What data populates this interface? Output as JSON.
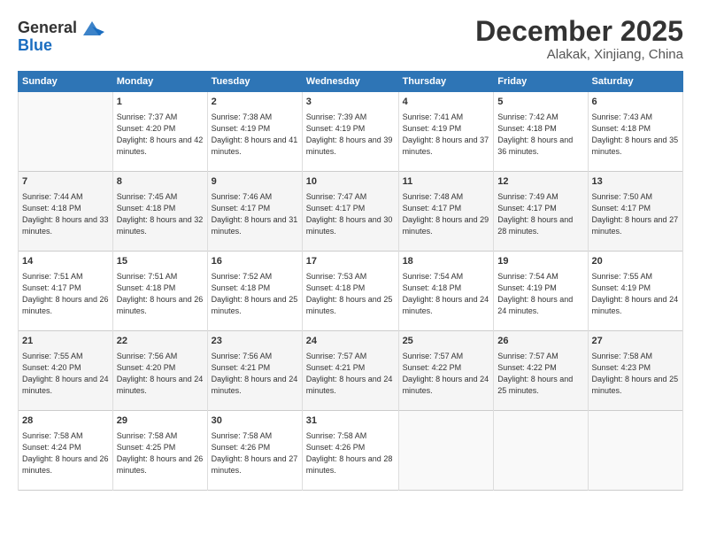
{
  "header": {
    "logo_line1": "General",
    "logo_line2": "Blue",
    "month_year": "December 2025",
    "location": "Alakak, Xinjiang, China"
  },
  "weekdays": [
    "Sunday",
    "Monday",
    "Tuesday",
    "Wednesday",
    "Thursday",
    "Friday",
    "Saturday"
  ],
  "weeks": [
    [
      {
        "day": "",
        "sunrise": "",
        "sunset": "",
        "daylight": ""
      },
      {
        "day": "1",
        "sunrise": "Sunrise: 7:37 AM",
        "sunset": "Sunset: 4:20 PM",
        "daylight": "Daylight: 8 hours and 42 minutes."
      },
      {
        "day": "2",
        "sunrise": "Sunrise: 7:38 AM",
        "sunset": "Sunset: 4:19 PM",
        "daylight": "Daylight: 8 hours and 41 minutes."
      },
      {
        "day": "3",
        "sunrise": "Sunrise: 7:39 AM",
        "sunset": "Sunset: 4:19 PM",
        "daylight": "Daylight: 8 hours and 39 minutes."
      },
      {
        "day": "4",
        "sunrise": "Sunrise: 7:41 AM",
        "sunset": "Sunset: 4:19 PM",
        "daylight": "Daylight: 8 hours and 37 minutes."
      },
      {
        "day": "5",
        "sunrise": "Sunrise: 7:42 AM",
        "sunset": "Sunset: 4:18 PM",
        "daylight": "Daylight: 8 hours and 36 minutes."
      },
      {
        "day": "6",
        "sunrise": "Sunrise: 7:43 AM",
        "sunset": "Sunset: 4:18 PM",
        "daylight": "Daylight: 8 hours and 35 minutes."
      }
    ],
    [
      {
        "day": "7",
        "sunrise": "Sunrise: 7:44 AM",
        "sunset": "Sunset: 4:18 PM",
        "daylight": "Daylight: 8 hours and 33 minutes."
      },
      {
        "day": "8",
        "sunrise": "Sunrise: 7:45 AM",
        "sunset": "Sunset: 4:18 PM",
        "daylight": "Daylight: 8 hours and 32 minutes."
      },
      {
        "day": "9",
        "sunrise": "Sunrise: 7:46 AM",
        "sunset": "Sunset: 4:17 PM",
        "daylight": "Daylight: 8 hours and 31 minutes."
      },
      {
        "day": "10",
        "sunrise": "Sunrise: 7:47 AM",
        "sunset": "Sunset: 4:17 PM",
        "daylight": "Daylight: 8 hours and 30 minutes."
      },
      {
        "day": "11",
        "sunrise": "Sunrise: 7:48 AM",
        "sunset": "Sunset: 4:17 PM",
        "daylight": "Daylight: 8 hours and 29 minutes."
      },
      {
        "day": "12",
        "sunrise": "Sunrise: 7:49 AM",
        "sunset": "Sunset: 4:17 PM",
        "daylight": "Daylight: 8 hours and 28 minutes."
      },
      {
        "day": "13",
        "sunrise": "Sunrise: 7:50 AM",
        "sunset": "Sunset: 4:17 PM",
        "daylight": "Daylight: 8 hours and 27 minutes."
      }
    ],
    [
      {
        "day": "14",
        "sunrise": "Sunrise: 7:51 AM",
        "sunset": "Sunset: 4:17 PM",
        "daylight": "Daylight: 8 hours and 26 minutes."
      },
      {
        "day": "15",
        "sunrise": "Sunrise: 7:51 AM",
        "sunset": "Sunset: 4:18 PM",
        "daylight": "Daylight: 8 hours and 26 minutes."
      },
      {
        "day": "16",
        "sunrise": "Sunrise: 7:52 AM",
        "sunset": "Sunset: 4:18 PM",
        "daylight": "Daylight: 8 hours and 25 minutes."
      },
      {
        "day": "17",
        "sunrise": "Sunrise: 7:53 AM",
        "sunset": "Sunset: 4:18 PM",
        "daylight": "Daylight: 8 hours and 25 minutes."
      },
      {
        "day": "18",
        "sunrise": "Sunrise: 7:54 AM",
        "sunset": "Sunset: 4:18 PM",
        "daylight": "Daylight: 8 hours and 24 minutes."
      },
      {
        "day": "19",
        "sunrise": "Sunrise: 7:54 AM",
        "sunset": "Sunset: 4:19 PM",
        "daylight": "Daylight: 8 hours and 24 minutes."
      },
      {
        "day": "20",
        "sunrise": "Sunrise: 7:55 AM",
        "sunset": "Sunset: 4:19 PM",
        "daylight": "Daylight: 8 hours and 24 minutes."
      }
    ],
    [
      {
        "day": "21",
        "sunrise": "Sunrise: 7:55 AM",
        "sunset": "Sunset: 4:20 PM",
        "daylight": "Daylight: 8 hours and 24 minutes."
      },
      {
        "day": "22",
        "sunrise": "Sunrise: 7:56 AM",
        "sunset": "Sunset: 4:20 PM",
        "daylight": "Daylight: 8 hours and 24 minutes."
      },
      {
        "day": "23",
        "sunrise": "Sunrise: 7:56 AM",
        "sunset": "Sunset: 4:21 PM",
        "daylight": "Daylight: 8 hours and 24 minutes."
      },
      {
        "day": "24",
        "sunrise": "Sunrise: 7:57 AM",
        "sunset": "Sunset: 4:21 PM",
        "daylight": "Daylight: 8 hours and 24 minutes."
      },
      {
        "day": "25",
        "sunrise": "Sunrise: 7:57 AM",
        "sunset": "Sunset: 4:22 PM",
        "daylight": "Daylight: 8 hours and 24 minutes."
      },
      {
        "day": "26",
        "sunrise": "Sunrise: 7:57 AM",
        "sunset": "Sunset: 4:22 PM",
        "daylight": "Daylight: 8 hours and 25 minutes."
      },
      {
        "day": "27",
        "sunrise": "Sunrise: 7:58 AM",
        "sunset": "Sunset: 4:23 PM",
        "daylight": "Daylight: 8 hours and 25 minutes."
      }
    ],
    [
      {
        "day": "28",
        "sunrise": "Sunrise: 7:58 AM",
        "sunset": "Sunset: 4:24 PM",
        "daylight": "Daylight: 8 hours and 26 minutes."
      },
      {
        "day": "29",
        "sunrise": "Sunrise: 7:58 AM",
        "sunset": "Sunset: 4:25 PM",
        "daylight": "Daylight: 8 hours and 26 minutes."
      },
      {
        "day": "30",
        "sunrise": "Sunrise: 7:58 AM",
        "sunset": "Sunset: 4:26 PM",
        "daylight": "Daylight: 8 hours and 27 minutes."
      },
      {
        "day": "31",
        "sunrise": "Sunrise: 7:58 AM",
        "sunset": "Sunset: 4:26 PM",
        "daylight": "Daylight: 8 hours and 28 minutes."
      },
      {
        "day": "",
        "sunrise": "",
        "sunset": "",
        "daylight": ""
      },
      {
        "day": "",
        "sunrise": "",
        "sunset": "",
        "daylight": ""
      },
      {
        "day": "",
        "sunrise": "",
        "sunset": "",
        "daylight": ""
      }
    ]
  ]
}
